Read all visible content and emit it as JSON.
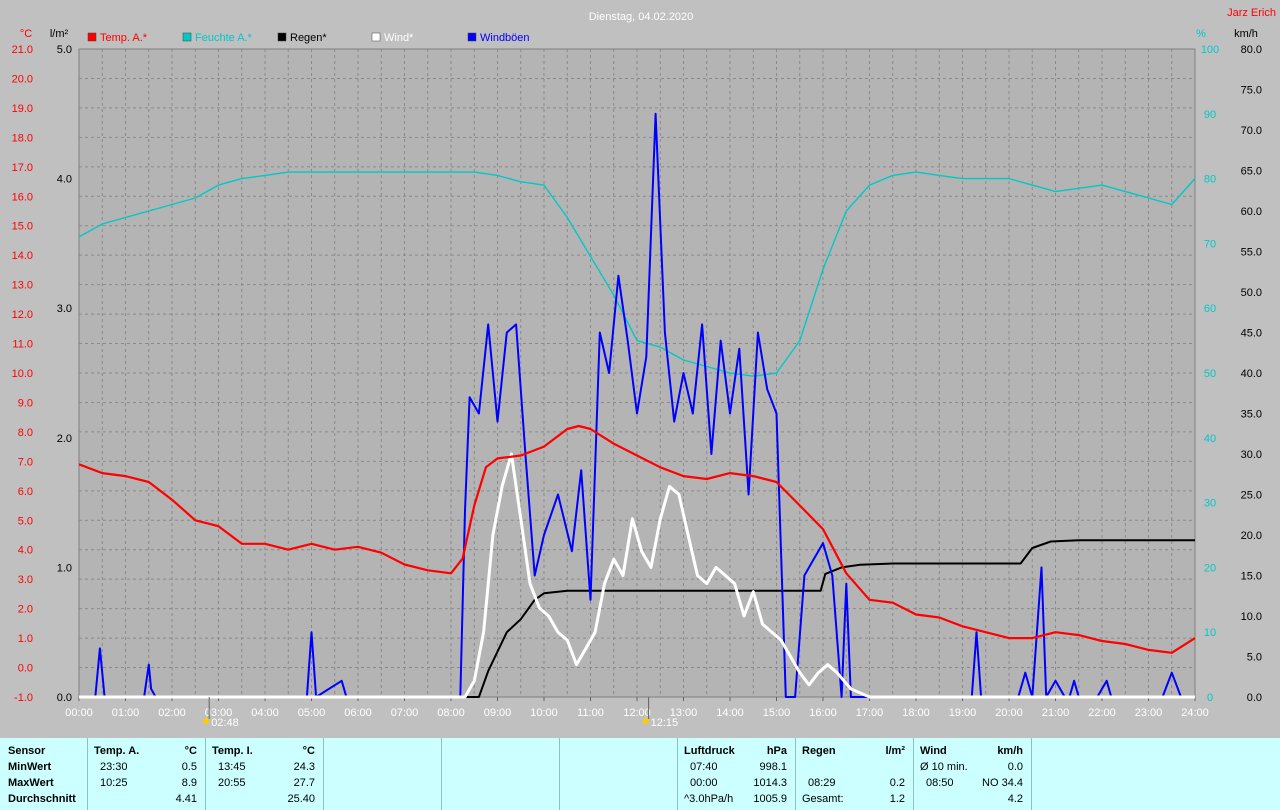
{
  "title": "Dienstag, 04.02.2020",
  "author": "Jarz Erich",
  "colors": {
    "temp": "#ff0000",
    "hum": "#00c8c8",
    "rain": "#000000",
    "wind": "#ffffff",
    "gust": "#0000ff",
    "background": "#c0c0c0",
    "panel": "#ccffff"
  },
  "legend": [
    {
      "key": "temp",
      "label": "Temp. A.*"
    },
    {
      "key": "hum",
      "label": "Feuchte A.*"
    },
    {
      "key": "rain",
      "label": "Regen*"
    },
    {
      "key": "wind",
      "label": "Wind*"
    },
    {
      "key": "gust",
      "label": "Windböen"
    }
  ],
  "axes": {
    "temp_unit": "°C",
    "rain_unit": "l/m²",
    "hum_unit": "%",
    "wind_unit": "km/h",
    "temp_ticks": [
      "21.0",
      "20.0",
      "19.0",
      "18.0",
      "17.0",
      "16.0",
      "15.0",
      "14.0",
      "13.0",
      "12.0",
      "11.0",
      "10.0",
      "9.0",
      "8.0",
      "7.0",
      "6.0",
      "5.0",
      "4.0",
      "3.0",
      "2.0",
      "1.0",
      "0.0",
      "-1.0"
    ],
    "rain_ticks": [
      "5.0",
      "4.0",
      "3.0",
      "2.0",
      "1.0",
      "0.0"
    ],
    "hum_ticks": [
      "100",
      "90",
      "80",
      "70",
      "60",
      "50",
      "40",
      "30",
      "20",
      "10",
      "0"
    ],
    "wind_ticks": [
      "80.0",
      "75.0",
      "70.0",
      "65.0",
      "60.0",
      "55.0",
      "50.0",
      "45.0",
      "40.0",
      "35.0",
      "30.0",
      "25.0",
      "20.0",
      "15.0",
      "10.0",
      "5.0",
      "0.0"
    ],
    "x_ticks": [
      "00:00",
      "01:00",
      "02:00",
      "03:00",
      "04:00",
      "05:00",
      "06:00",
      "07:00",
      "08:00",
      "09:00",
      "10:00",
      "11:00",
      "12:00",
      "13:00",
      "14:00",
      "15:00",
      "16:00",
      "17:00",
      "18:00",
      "19:00",
      "20:00",
      "21:00",
      "22:00",
      "23:00",
      "24:00"
    ],
    "sun_markers": [
      {
        "label": "02:48",
        "hour": 2.8
      },
      {
        "label": "12:15",
        "hour": 12.25
      }
    ]
  },
  "chart_data": {
    "type": "line",
    "title": "Dienstag, 04.02.2020",
    "x_unit": "hours",
    "xlim": [
      0,
      24
    ],
    "temp_ylim": [
      -1,
      21
    ],
    "rain_ylim": [
      0,
      5
    ],
    "hum_ylim": [
      0,
      100
    ],
    "wind_ylim": [
      0,
      80
    ],
    "grid": true,
    "series": [
      {
        "name": "Temp. A.*",
        "axis": "temp",
        "x": [
          0,
          0.5,
          1,
          1.5,
          2,
          2.5,
          3,
          3.5,
          4,
          4.5,
          5,
          5.5,
          6,
          6.5,
          7,
          7.5,
          8,
          8.25,
          8.5,
          8.75,
          9,
          9.5,
          10,
          10.5,
          10.75,
          11,
          11.5,
          12,
          12.5,
          13,
          13.5,
          14,
          14.5,
          15,
          15.5,
          16,
          16.5,
          17,
          17.5,
          18,
          18.5,
          19,
          19.5,
          20,
          20.5,
          21,
          21.5,
          22,
          22.5,
          23,
          23.5,
          24
        ],
        "y": [
          6.9,
          6.6,
          6.5,
          6.3,
          5.7,
          5.0,
          4.8,
          4.2,
          4.2,
          4.0,
          4.2,
          4.0,
          4.1,
          3.9,
          3.5,
          3.3,
          3.2,
          3.7,
          5.5,
          6.8,
          7.1,
          7.2,
          7.5,
          8.1,
          8.2,
          8.1,
          7.6,
          7.2,
          6.8,
          6.5,
          6.4,
          6.6,
          6.5,
          6.3,
          5.5,
          4.7,
          3.2,
          2.3,
          2.2,
          1.8,
          1.7,
          1.4,
          1.2,
          1.0,
          1.0,
          1.2,
          1.1,
          0.9,
          0.8,
          0.6,
          0.5,
          1.0
        ]
      },
      {
        "name": "Feuchte A.*",
        "axis": "hum",
        "x": [
          0,
          0.5,
          1,
          1.5,
          2,
          2.5,
          3,
          3.5,
          4,
          4.5,
          5,
          6,
          7,
          8,
          8.5,
          9,
          9.5,
          10,
          10.5,
          11,
          11.5,
          12,
          12.5,
          13,
          13.5,
          14,
          14.5,
          15,
          15.5,
          16,
          16.5,
          17,
          17.5,
          18,
          18.5,
          19,
          19.5,
          20,
          20.5,
          21,
          21.5,
          22,
          22.5,
          23,
          23.5,
          24
        ],
        "y": [
          71,
          73,
          74,
          75,
          76,
          77,
          79,
          80,
          80.5,
          81,
          81,
          81,
          81,
          81,
          81,
          80.5,
          79.5,
          79,
          74,
          68,
          62,
          55,
          54,
          52,
          51,
          50,
          49.5,
          50,
          55,
          66,
          75,
          79,
          80.5,
          81,
          80.5,
          80,
          80,
          80,
          79,
          78,
          78.5,
          79,
          78,
          77,
          76,
          80
        ]
      },
      {
        "name": "Regen*",
        "axis": "rain",
        "x": [
          0,
          8.6,
          8.8,
          9.2,
          9.5,
          9.8,
          10,
          10.5,
          11,
          12,
          13,
          14,
          15,
          15.5,
          15.95,
          16.05,
          16.4,
          16.8,
          17.5,
          18,
          19,
          20,
          20.25,
          20.5,
          20.9,
          21.5,
          22,
          23,
          24
        ],
        "y": [
          0,
          0,
          0.2,
          0.5,
          0.6,
          0.75,
          0.8,
          0.82,
          0.82,
          0.82,
          0.82,
          0.82,
          0.82,
          0.82,
          0.82,
          0.95,
          1.0,
          1.02,
          1.03,
          1.03,
          1.03,
          1.03,
          1.03,
          1.15,
          1.2,
          1.21,
          1.21,
          1.21,
          1.21
        ]
      },
      {
        "name": "Wind*",
        "axis": "wind",
        "x": [
          0,
          8.3,
          8.5,
          8.7,
          8.9,
          9.1,
          9.3,
          9.5,
          9.7,
          9.9,
          10.1,
          10.3,
          10.5,
          10.7,
          10.9,
          11.1,
          11.3,
          11.5,
          11.7,
          11.9,
          12.1,
          12.3,
          12.5,
          12.7,
          12.9,
          13.1,
          13.3,
          13.5,
          13.7,
          13.9,
          14.1,
          14.3,
          14.5,
          14.7,
          14.9,
          15.1,
          15.3,
          15.5,
          15.7,
          15.9,
          16.1,
          16.3,
          16.6,
          17,
          24
        ],
        "y": [
          0,
          0,
          2,
          8,
          20,
          26,
          30,
          22,
          14,
          11,
          10,
          8,
          7,
          4,
          6,
          8,
          14,
          17,
          15,
          22,
          18,
          16,
          22,
          26,
          25,
          20,
          15,
          14,
          16,
          15,
          14,
          10,
          13,
          9,
          8,
          7,
          5,
          3,
          1.5,
          3,
          4,
          3,
          1,
          0,
          0
        ]
      },
      {
        "name": "Windböen",
        "axis": "wind",
        "x": [
          0,
          0.35,
          0.45,
          0.55,
          1.4,
          1.5,
          1.55,
          1.65,
          4.9,
          5.0,
          5.1,
          5.65,
          5.75,
          8.2,
          8.3,
          8.4,
          8.6,
          8.8,
          9.0,
          9.2,
          9.4,
          9.6,
          9.8,
          10.0,
          10.3,
          10.6,
          10.8,
          11.0,
          11.2,
          11.4,
          11.6,
          11.8,
          12.0,
          12.2,
          12.4,
          12.6,
          12.8,
          13.0,
          13.2,
          13.4,
          13.6,
          13.8,
          14.0,
          14.2,
          14.4,
          14.6,
          14.8,
          15.0,
          15.2,
          15.4,
          15.6,
          15.8,
          16.0,
          16.2,
          16.4,
          16.5,
          16.6,
          16.8,
          17.0,
          19.2,
          19.3,
          19.4,
          20.2,
          20.35,
          20.5,
          20.7,
          20.8,
          21.0,
          21.2,
          21.3,
          21.4,
          21.5,
          21.9,
          22.1,
          22.2,
          23.3,
          23.5,
          23.7,
          24
        ],
        "y": [
          0,
          0,
          6,
          0,
          0,
          4,
          1,
          0,
          0,
          8,
          0,
          2,
          0,
          0,
          23,
          37,
          35,
          46,
          34,
          45,
          46,
          30,
          15,
          20,
          25,
          18,
          28,
          12,
          45,
          40,
          52,
          44,
          35,
          42,
          72,
          45,
          34,
          40,
          35,
          46,
          30,
          44,
          35,
          43,
          25,
          45,
          38,
          35,
          0,
          0,
          15,
          17,
          19,
          15,
          0,
          14,
          0,
          0,
          0,
          0,
          8,
          0,
          0,
          3,
          0,
          16,
          0,
          2,
          0,
          0,
          2,
          0,
          0,
          2,
          0,
          0,
          3,
          0,
          0
        ]
      }
    ]
  },
  "panel": {
    "sensor_header": "Sensor",
    "row_labels": [
      "MinWert",
      "MaxWert",
      "Durchschnitt"
    ],
    "temp_a": {
      "title": "Temp. A.",
      "unit": "°C",
      "min_time": "23:30",
      "min_val": "0.5",
      "max_time": "10:25",
      "max_val": "8.9",
      "avg": "4.41"
    },
    "temp_i": {
      "title": "Temp. I.",
      "unit": "°C",
      "min_time": "13:45",
      "min_val": "24.3",
      "max_time": "20:55",
      "max_val": "27.7",
      "avg": "25.40"
    },
    "pressure": {
      "title": "Luftdruck",
      "unit": "hPa",
      "min_time": "07:40",
      "min_val": "998.1",
      "max_time": "00:00",
      "max_val": "1014.3",
      "trend_label": "^3.0hPa/h",
      "trend_val": "1005.9"
    },
    "rain": {
      "title": "Regen",
      "unit": "l/m²",
      "max_time": "08:29",
      "max_val": "0.2",
      "total_label": "Gesamt:",
      "total_val": "1.2"
    },
    "wind": {
      "title": "Wind",
      "unit": "km/h",
      "min_label": "Ø 10 min.",
      "min_val": "0.0",
      "max_time": "08:50",
      "max_val": "NO 34.4",
      "avg": "4.2"
    }
  }
}
